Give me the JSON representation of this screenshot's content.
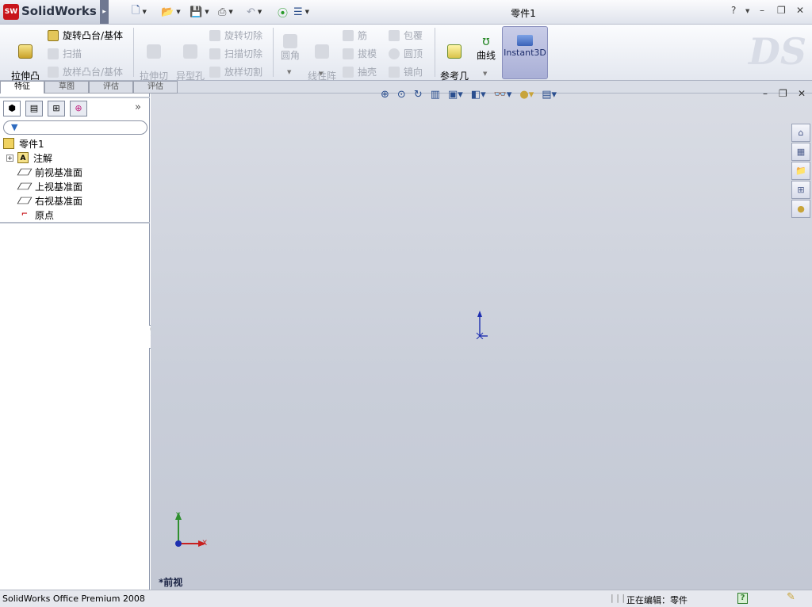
{
  "app": {
    "logo_text": "SolidWorks",
    "logo_badge": "SW",
    "doc_title": "零件1"
  },
  "quick_access": [
    "new",
    "open",
    "save",
    "print",
    "undo",
    "rebuild",
    "options"
  ],
  "window_controls": {
    "help": "?",
    "minimize": "–",
    "restore": "❐",
    "close": "✕"
  },
  "ribbon": {
    "extrude_boss": "拉伸凸\n台/基体",
    "revolve_boss": "旋转凸台/基体",
    "sweep_boss": "扫描",
    "loft_boss": "放样凸台/基体",
    "extrude_cut": "拉伸切\n除",
    "hole_wizard": "异型孔\n向导",
    "revolve_cut": "旋转切除",
    "sweep_cut": "扫描切除",
    "loft_cut": "放样切割",
    "fillet": "圆角",
    "linear_pattern": "线性阵\n列",
    "rib": "筋",
    "draft": "拔模",
    "shell": "抽壳",
    "wrap": "包覆",
    "dome": "圆顶",
    "mirror": "镜向",
    "ref_geometry": "参考几\n何体",
    "curves": "曲线",
    "instant3d": "Instant3D"
  },
  "command_tabs": [
    "特征",
    "草图",
    "评估",
    "评估"
  ],
  "tree": {
    "root": "零件1",
    "annotations": "注解",
    "front_plane": "前视基准面",
    "top_plane": "上视基准面",
    "right_plane": "右视基准面",
    "origin": "原点"
  },
  "viewport": {
    "view_name": "*前视",
    "axis_x": "X",
    "axis_y": "Y"
  },
  "status": {
    "product": "SolidWorks Office Premium 2008",
    "editing": "正在编辑：零件"
  },
  "colors": {
    "accent": "#c8151b",
    "viewport_bg": "#c9ced9",
    "origin_blue": "#1e2fb0"
  }
}
